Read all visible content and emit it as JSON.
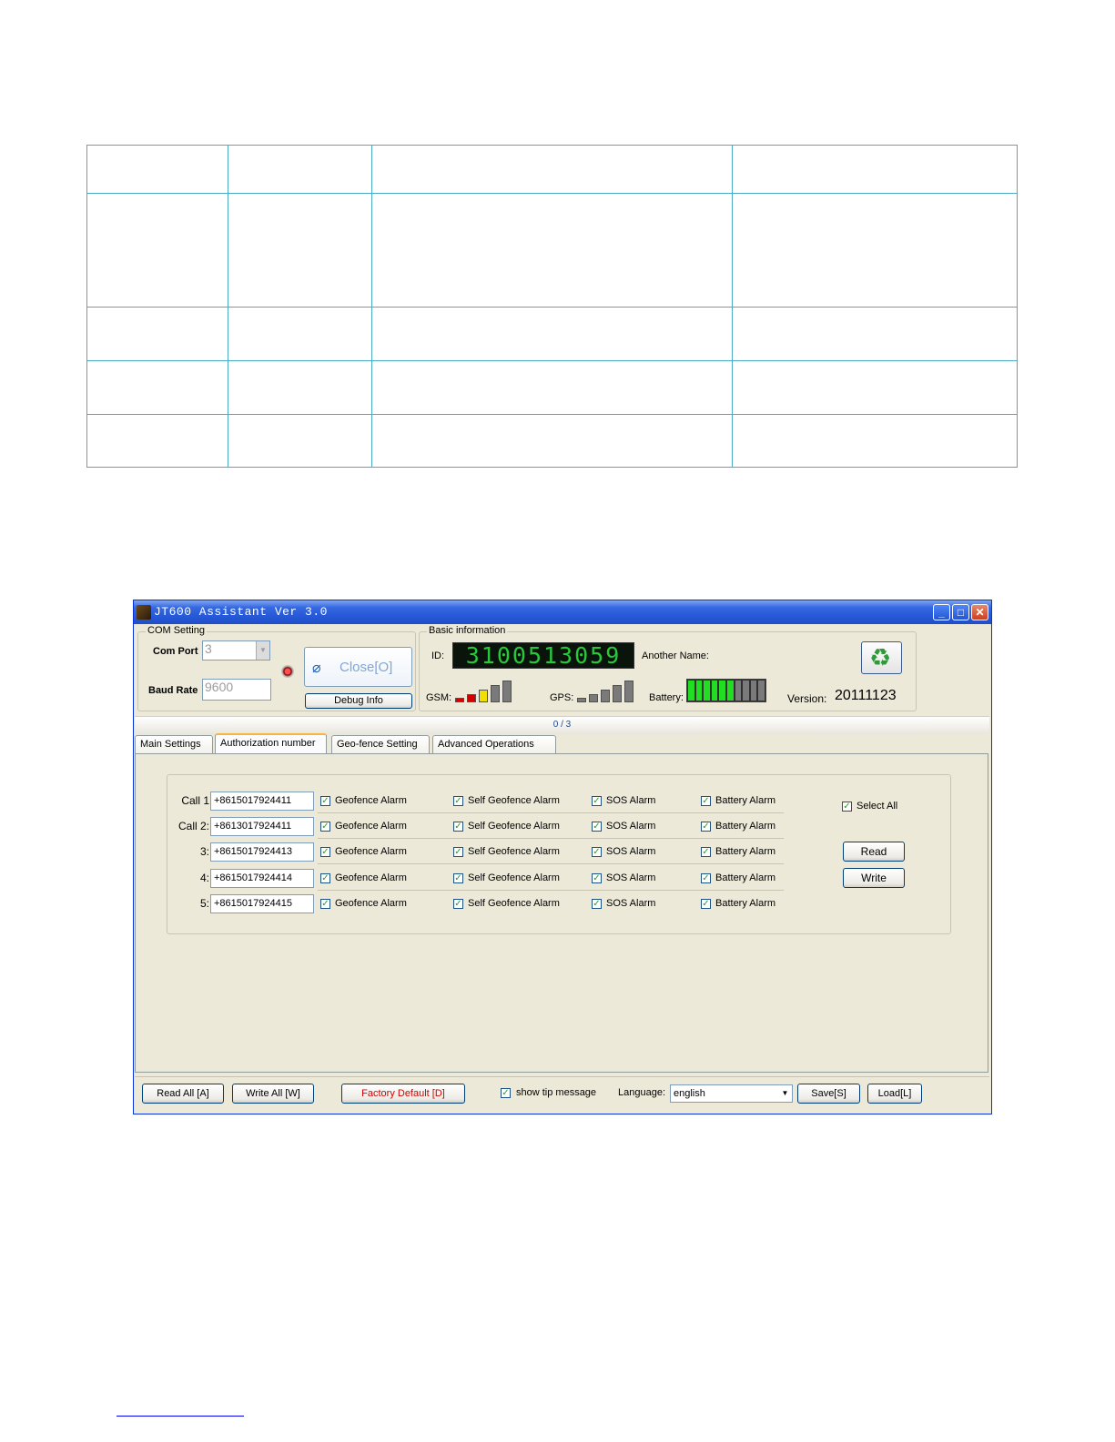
{
  "window": {
    "title": "JT600 Assistant Ver 3.0",
    "min_icon": "minimize-icon",
    "max_icon": "maximize-icon",
    "close_icon": "close-icon"
  },
  "com_setting": {
    "legend": "COM Setting",
    "port_label": "Com Port",
    "port_value": "3",
    "baud_label": "Baud Rate",
    "baud_value": "9600",
    "close_button": "Close[O]",
    "debug_button": "Debug Info"
  },
  "basic_info": {
    "legend": "Basic information",
    "id_label": "ID:",
    "id_value": "3100513059",
    "another_name_label": "Another Name:",
    "gsm_label": "GSM:",
    "gps_label": "GPS:",
    "battery_label": "Battery:",
    "version_label": "Version:",
    "version_value": "20111123",
    "gsm_level": 3,
    "gps_level": 0,
    "battery_level": 6,
    "battery_segments": 10,
    "refresh_icon": "recycle-icon"
  },
  "progress": {
    "text": "0 / 3"
  },
  "tabs": [
    "Main Settings",
    "Authorization number",
    "Geo-fence Setting",
    "Advanced Operations"
  ],
  "authorization": {
    "rows": [
      {
        "label": "Call 1",
        "number": "+8615017924411"
      },
      {
        "label": "Call 2:",
        "number": "+8613017924411"
      },
      {
        "label": "3:",
        "number": "+8615017924413"
      },
      {
        "label": "4:",
        "number": "+8615017924414"
      },
      {
        "label": "5:",
        "number": "+8615017924415"
      }
    ],
    "alarms": [
      "Geofence Alarm",
      "Self Geofence Alarm",
      "SOS Alarm",
      "Battery Alarm"
    ],
    "select_all": "Select All",
    "read_button": "Read",
    "write_button": "Write",
    "check_mark": "✓"
  },
  "footer": {
    "read_all": "Read All [A]",
    "write_all": "Write All [W]",
    "factory_default": "Factory Default [D]",
    "show_tip": "show tip message",
    "language_label": "Language:",
    "language_value": "english",
    "save": "Save[S]",
    "load": "Load[L]"
  },
  "colors": {
    "led_text": "#28c83c",
    "gsm_bars": [
      "#d40000",
      "#d40000",
      "#f0e000",
      "#7a7a7a",
      "#7a7a7a"
    ],
    "battery_on": "#22dd22",
    "battery_off": "#7a7a7a",
    "table_border": "#4bacc6"
  }
}
